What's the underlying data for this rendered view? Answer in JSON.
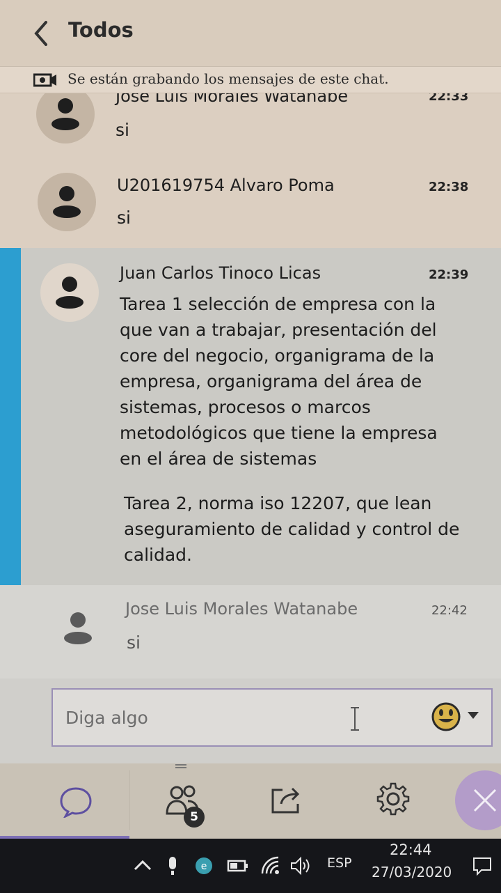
{
  "header": {
    "title": "Todos",
    "back_icon": "chevron-left-icon"
  },
  "recording_notice": {
    "icon": "video-camera-icon",
    "text": "Se están grabando los mensajes de este chat."
  },
  "messages": [
    {
      "author": "Jose Luis Morales Watanabe",
      "time": "22:33",
      "body": "si"
    },
    {
      "author": "U201619754 Alvaro Poma",
      "time": "22:38",
      "body": "si"
    },
    {
      "author": "Juan Carlos Tinoco Licas",
      "time": "22:39",
      "body_lines": [
        "Tarea 1 selección de empresa con la",
        "que van a trabajar, presentación del",
        "core del negocio, organigrama de la",
        "empresa, organigrama del área de",
        "sistemas, procesos o marcos",
        "metodológicos que tiene la empresa",
        "en el área de sistemas"
      ],
      "body_lines_2": [
        "Tarea 2, norma iso 12207, que lean",
        "aseguramiento de calidad y control de",
        "calidad."
      ]
    },
    {
      "author": "Jose Luis Morales Watanabe",
      "time": "22:42",
      "body": "si"
    }
  ],
  "composer": {
    "placeholder": "Diga algo",
    "emoji_icon": "emoji-smile-icon"
  },
  "toolbar": {
    "participants_count": "5",
    "items": [
      "chat-icon",
      "participants-icon",
      "share-icon",
      "gear-icon",
      "close-icon"
    ]
  },
  "taskbar": {
    "language": "ESP",
    "time": "22:44",
    "date": "27/03/2020"
  },
  "colors": {
    "accent_purple": "#7d6fb5",
    "accent_blue": "#2c9ed0",
    "close_button": "#b39cc9"
  }
}
